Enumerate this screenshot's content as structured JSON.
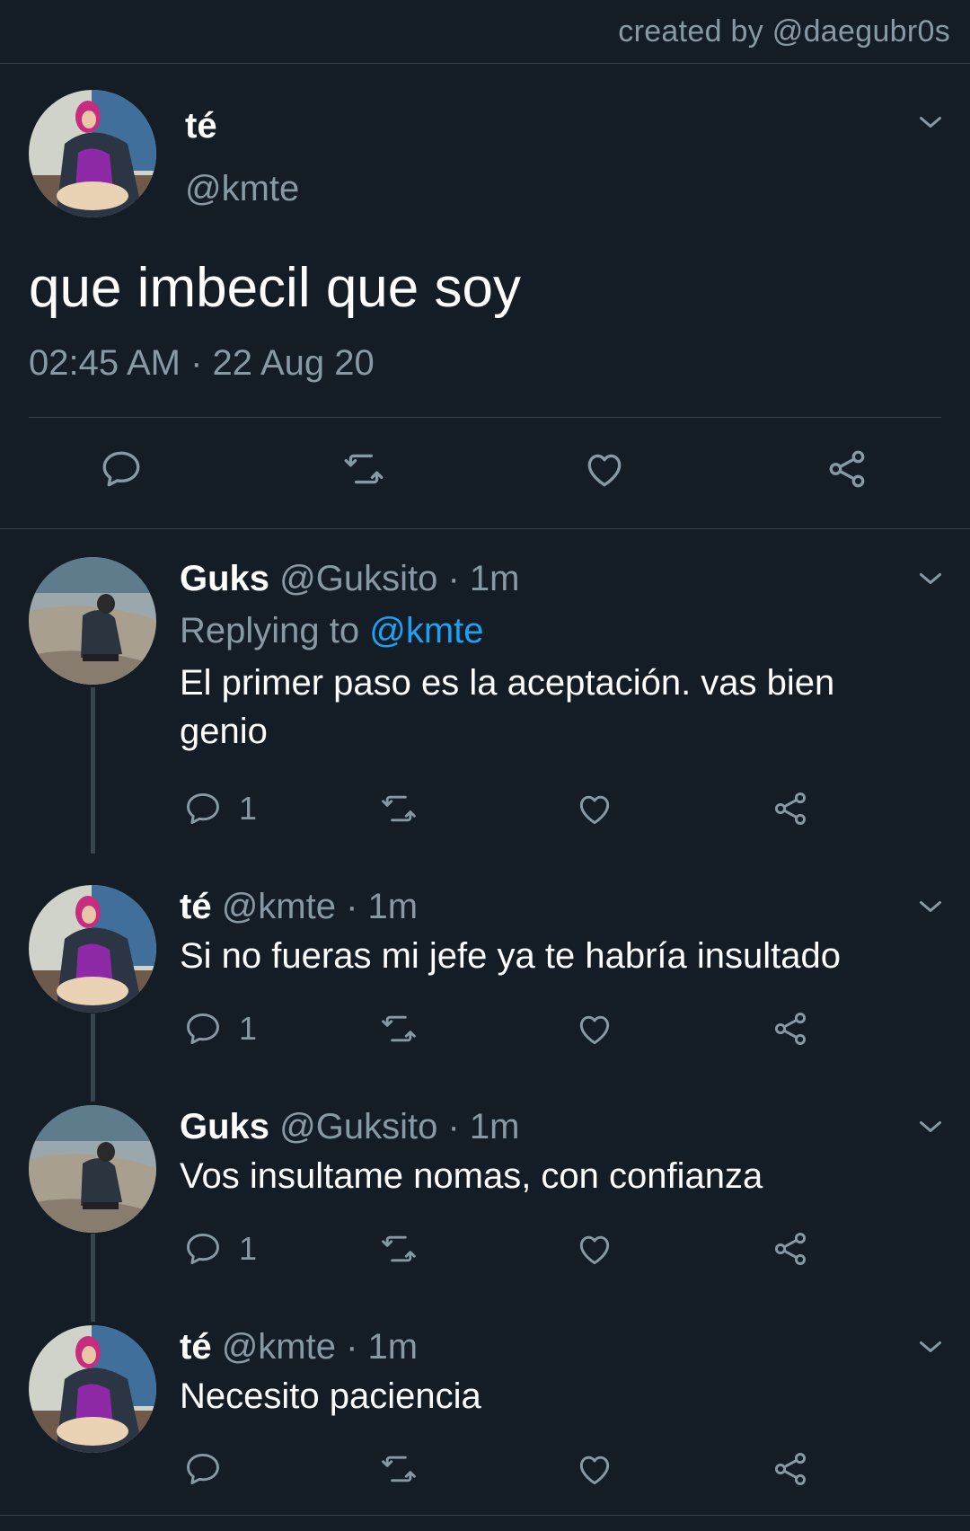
{
  "credit": "created by @daegubr0s",
  "main_tweet": {
    "name": "té",
    "handle": "@kmte",
    "text": "que imbecil que soy",
    "timestamp": "02:45 AM · 22 Aug 20"
  },
  "replies": [
    {
      "name": "Guks",
      "meta": "@Guksito · 1m",
      "replying_label": "Replying to",
      "replying_mention": "@kmte",
      "text": "El primer paso es la aceptación. vas bien genio",
      "reply_count": "1"
    },
    {
      "name": "té",
      "meta": "@kmte · 1m",
      "text": "Si no fueras mi jefe ya te habría insultado",
      "reply_count": "1"
    },
    {
      "name": "Guks",
      "meta": "@Guksito · 1m",
      "text": "Vos insultame nomas, con confianza",
      "reply_count": "1"
    },
    {
      "name": "té",
      "meta": "@kmte · 1m",
      "text": "Necesito paciencia",
      "reply_count": ""
    }
  ],
  "colors": {
    "background": "#141d26",
    "secondary_text": "#8899a6",
    "mention": "#1da1f2",
    "divider": "#38444d"
  },
  "icons": [
    "reply-icon",
    "retweet-icon",
    "like-icon",
    "share-icon",
    "chevron-down-icon"
  ]
}
